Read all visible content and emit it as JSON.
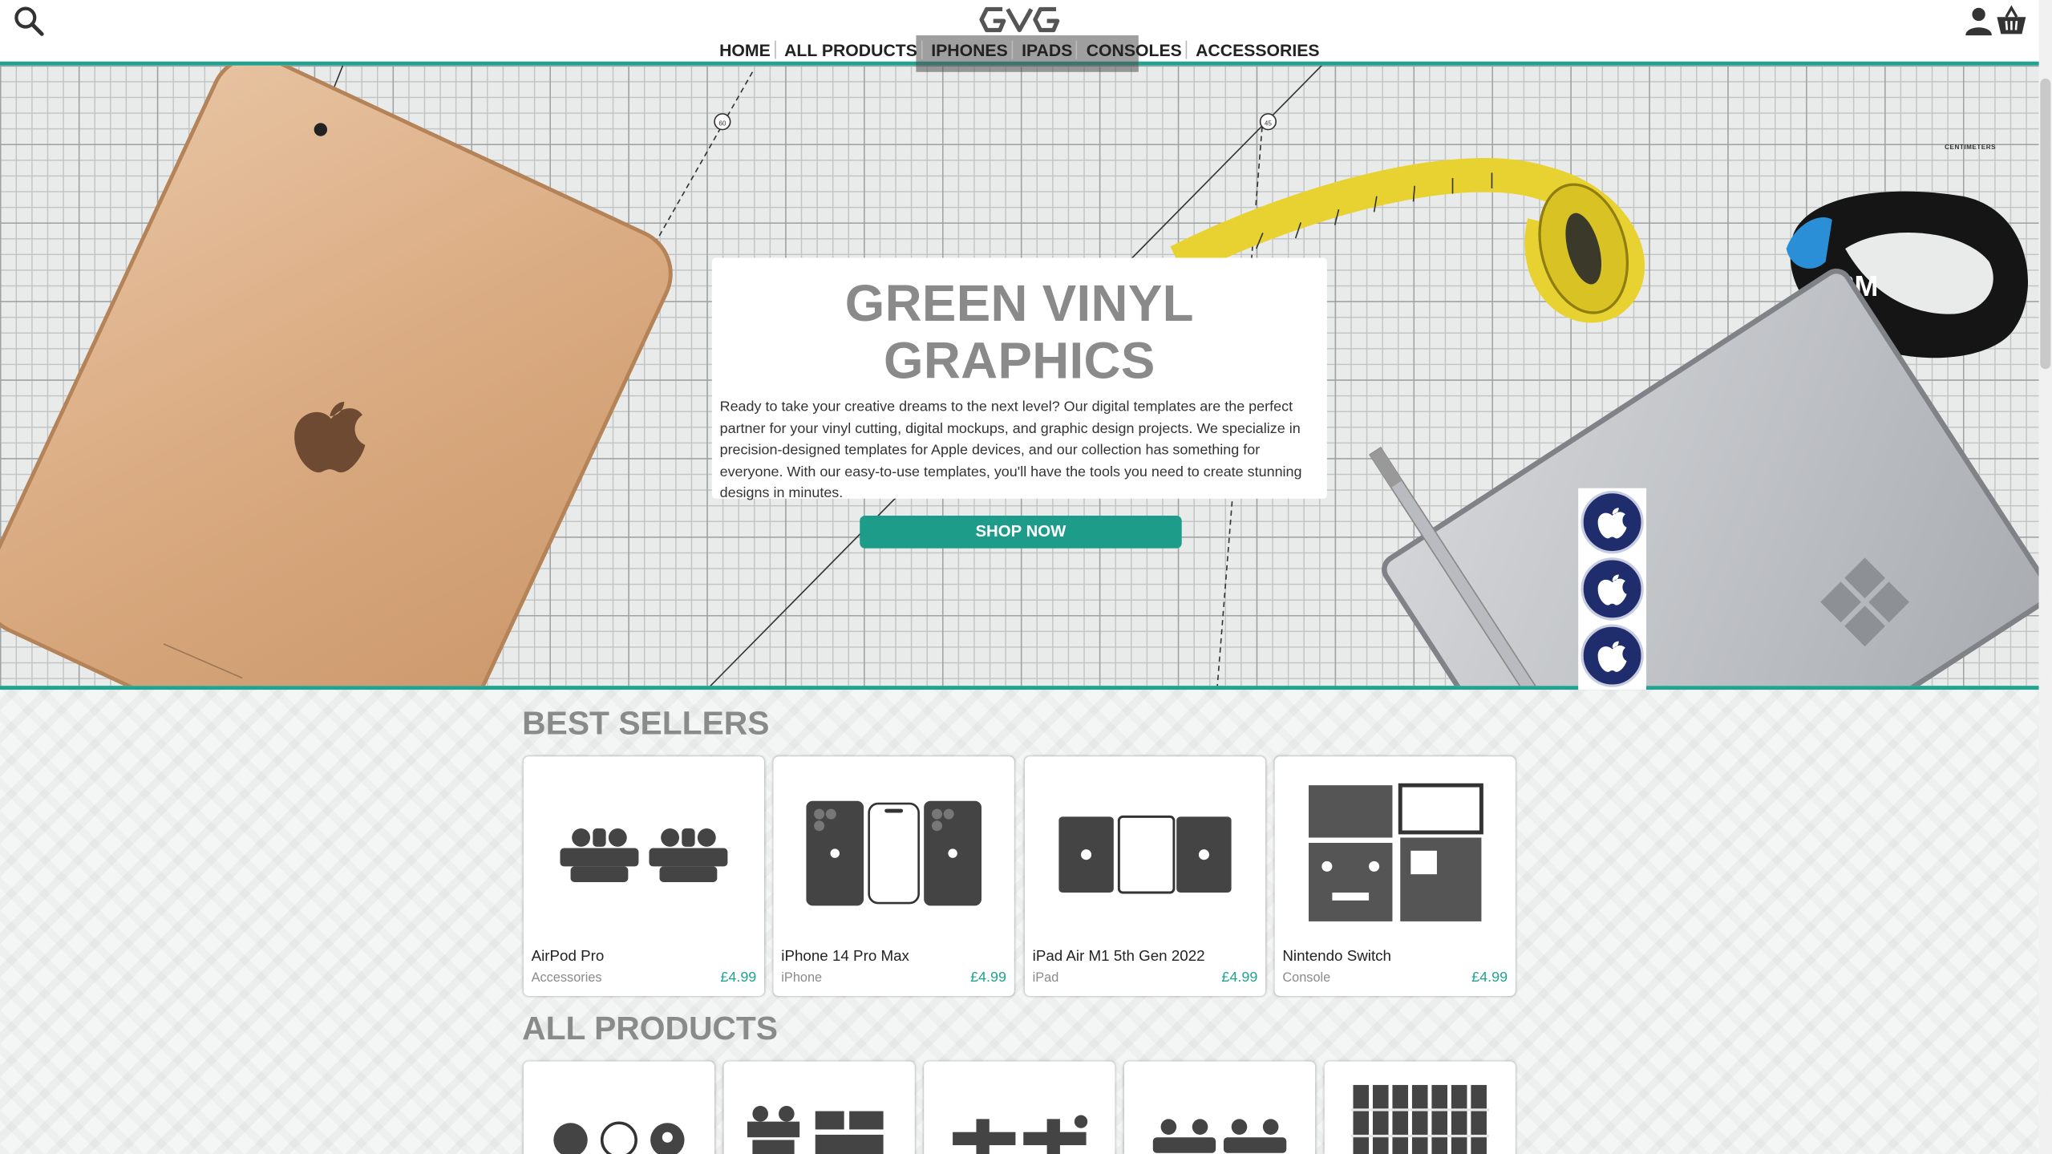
{
  "header": {
    "logo_text": "GVG",
    "nav": [
      "HOME",
      "ALL PRODUCTS",
      "IPHONES",
      "IPADS",
      "CONSOLES",
      "ACCESSORIES"
    ],
    "icons": {
      "search": "search-icon",
      "account": "user-icon",
      "basket": "basket-icon"
    },
    "accent_color": "#22a290"
  },
  "hero": {
    "title": "GREEN VINYL GRAPHICS",
    "description": "Ready to take your creative dreams to the next level? Our digital templates are the perfect partner for your vinyl cutting, digital mockups, and graphic design projects. We specialize in precision-designed templates for Apple devices, and our collection has something for everyone. With our easy-to-use templates, you'll have the tools you need to create stunning designs in minutes.",
    "cta": "SHOP NOW",
    "photo_text": {
      "ipad": "iPad",
      "cutter": "3M",
      "mat": "CENTIMETERS",
      "angle_a": "60",
      "angle_b": "45"
    }
  },
  "best_sellers": {
    "title": "BEST SELLERS",
    "items": [
      {
        "name": "AirPod Pro",
        "category": "Accessories",
        "price": "£4.99"
      },
      {
        "name": "iPhone 14 Pro Max",
        "category": "iPhone",
        "price": "£4.99"
      },
      {
        "name": "iPad Air M1 5th Gen 2022",
        "category": "iPad",
        "price": "£4.99"
      },
      {
        "name": "Nintendo Switch",
        "category": "Console",
        "price": "£4.99"
      }
    ]
  },
  "all_products": {
    "title": "ALL PRODUCTS",
    "count_visible": 5
  }
}
